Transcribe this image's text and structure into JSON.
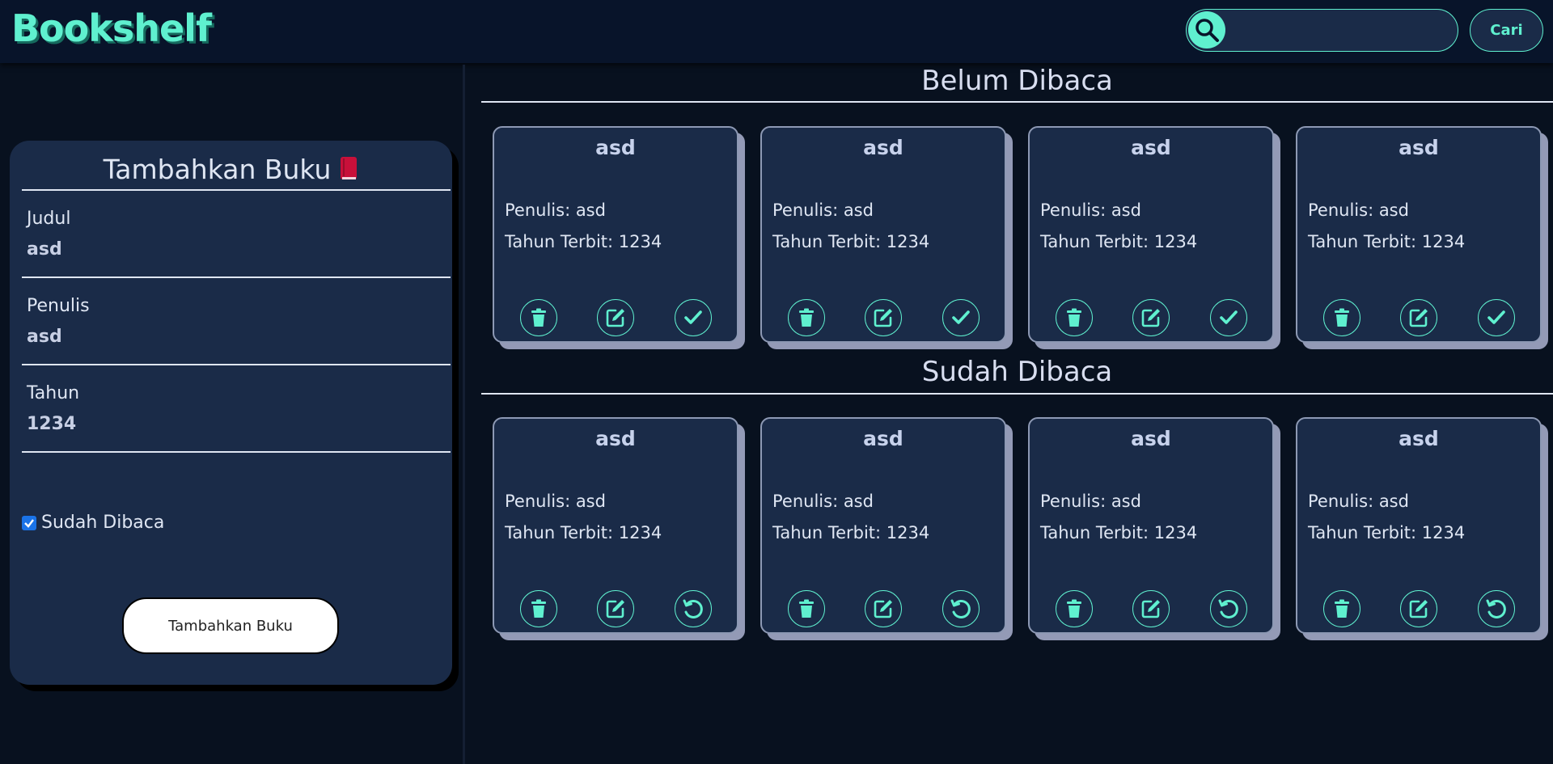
{
  "header": {
    "logo": "Bookshelf",
    "search_placeholder": "",
    "search_button": "Cari"
  },
  "form": {
    "title": "Tambahkan Buku",
    "title_icon": "book-icon",
    "fields": [
      {
        "label": "Judul",
        "value": "asd"
      },
      {
        "label": "Penulis",
        "value": "asd"
      },
      {
        "label": "Tahun",
        "value": "1234"
      }
    ],
    "checkbox_label": "Sudah Dibaca",
    "checkbox_checked": true,
    "submit_label": "Tambahkan Buku"
  },
  "sections": {
    "unread": {
      "title": "Belum Dibaca",
      "books": [
        {
          "title": "asd",
          "author": "Penulis: asd",
          "year": "Tahun Terbit: 1234"
        },
        {
          "title": "asd",
          "author": "Penulis: asd",
          "year": "Tahun Terbit: 1234"
        },
        {
          "title": "asd",
          "author": "Penulis: asd",
          "year": "Tahun Terbit: 1234"
        },
        {
          "title": "asd",
          "author": "Penulis: asd",
          "year": "Tahun Terbit: 1234"
        }
      ],
      "actions": [
        "trash-icon",
        "edit-icon",
        "check-icon"
      ]
    },
    "read": {
      "title": "Sudah Dibaca",
      "books": [
        {
          "title": "asd",
          "author": "Penulis: asd",
          "year": "Tahun Terbit: 1234"
        },
        {
          "title": "asd",
          "author": "Penulis: asd",
          "year": "Tahun Terbit: 1234"
        },
        {
          "title": "asd",
          "author": "Penulis: asd",
          "year": "Tahun Terbit: 1234"
        },
        {
          "title": "asd",
          "author": "Penulis: asd",
          "year": "Tahun Terbit: 1234"
        }
      ],
      "actions": [
        "trash-icon",
        "edit-icon",
        "undo-icon"
      ]
    }
  },
  "colors": {
    "accent": "#5ff0cf",
    "background": "#08111f",
    "card": "#1a2b48"
  }
}
